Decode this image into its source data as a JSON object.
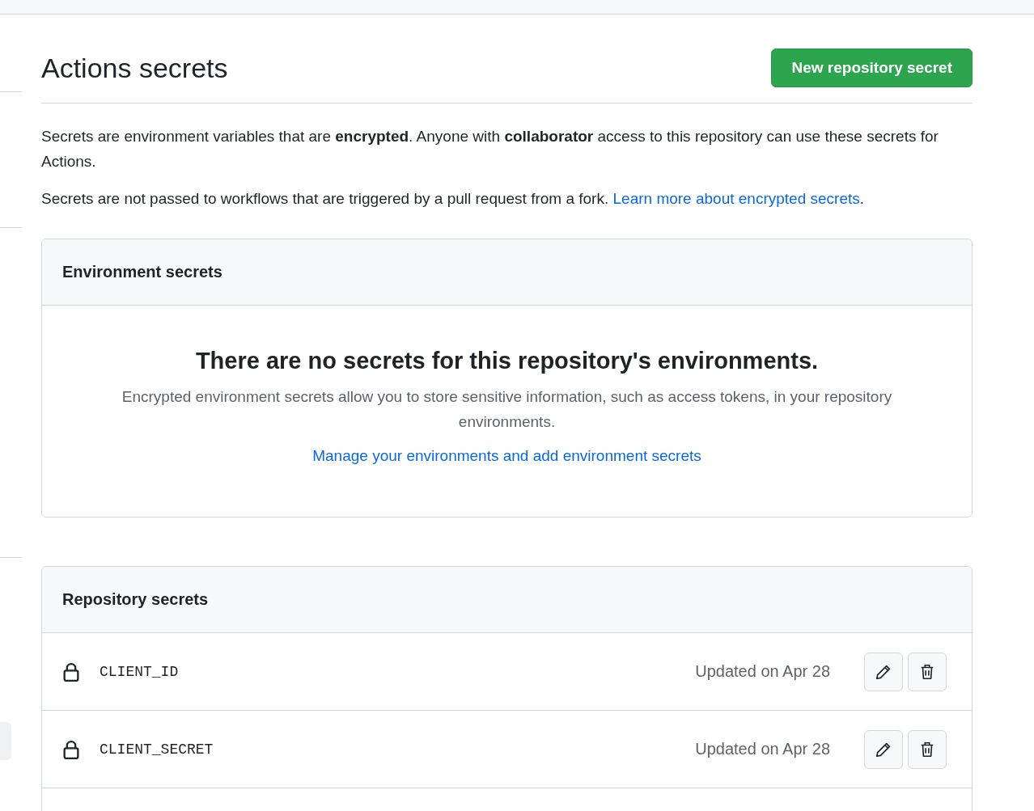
{
  "header": {
    "title": "Actions secrets",
    "new_button": "New repository secret"
  },
  "intro": [
    "Secrets are environment variables that are **encrypted**. Anyone with **collaborator** access to this repository can use these secrets for Actions.",
    "Secrets are not passed to workflows that are triggered by a pull request from a fork."
  ],
  "intro_link": "Learn more about encrypted secrets",
  "intro_link_end": ".",
  "environment_secrets": {
    "title": "Environment secrets",
    "empty_title": "There are no secrets for this repository's environments.",
    "empty_description": "Encrypted environment secrets allow you to store sensitive information, such as access tokens, in your repository environments.",
    "link": "Manage your environments and add environment secrets"
  },
  "repository_secrets": {
    "title": "Repository secrets",
    "rows": [
      {
        "name": "CLIENT_ID",
        "updated": "Updated on Apr 28"
      },
      {
        "name": "CLIENT_SECRET",
        "updated": "Updated on Apr 28"
      }
    ]
  }
}
